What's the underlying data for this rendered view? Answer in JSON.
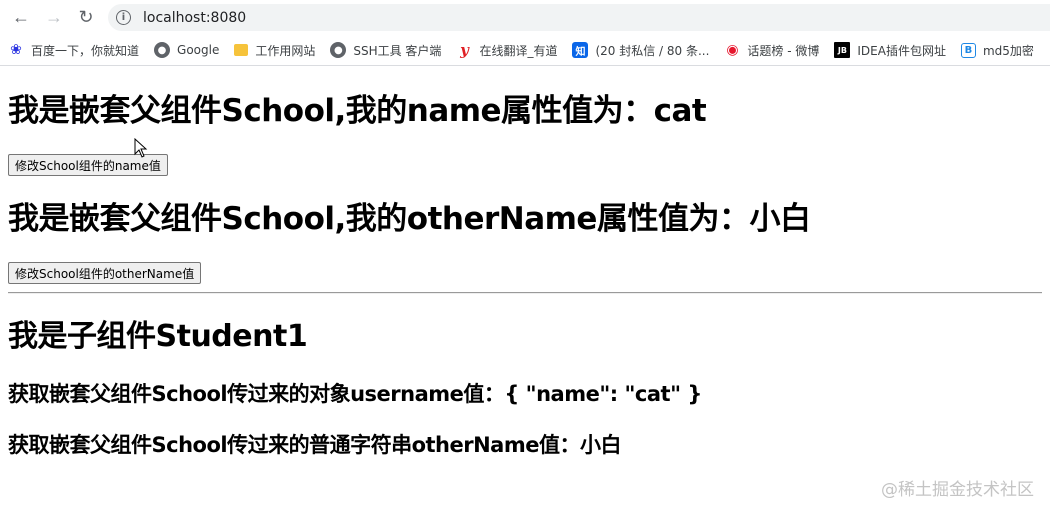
{
  "browser": {
    "url": "localhost:8080",
    "bookmarks": [
      {
        "icon": "baidu-paw-icon",
        "label": "百度一下，你就知道"
      },
      {
        "icon": "globe-icon",
        "label": "Google"
      },
      {
        "icon": "folder-icon",
        "label": "工作用网站"
      },
      {
        "icon": "globe-icon",
        "label": "SSH工具 客户端"
      },
      {
        "icon": "youdao-icon",
        "label": "在线翻译_有道"
      },
      {
        "icon": "zhihu-icon",
        "label": "(20 封私信 / 80 条..."
      },
      {
        "icon": "weibo-icon",
        "label": "话题榜 - 微博"
      },
      {
        "icon": "jetbrains-icon",
        "label": "IDEA插件包网址"
      },
      {
        "icon": "b-icon",
        "label": "md5加密"
      }
    ]
  },
  "page": {
    "school_name_heading": "我是嵌套父组件School,我的name属性值为：cat",
    "change_name_button": "修改School组件的name值",
    "school_othername_heading": "我是嵌套父组件School,我的otherName属性值为：小白",
    "change_othername_button": "修改School组件的otherName值",
    "student_heading": "我是子组件Student1",
    "object_line": "获取嵌套父组件School传过来的对象username值：{ \"name\": \"cat\" }",
    "string_line": "获取嵌套父组件School传过来的普通字符串otherName值：小白"
  },
  "watermark": "@稀土掘金技术社区"
}
